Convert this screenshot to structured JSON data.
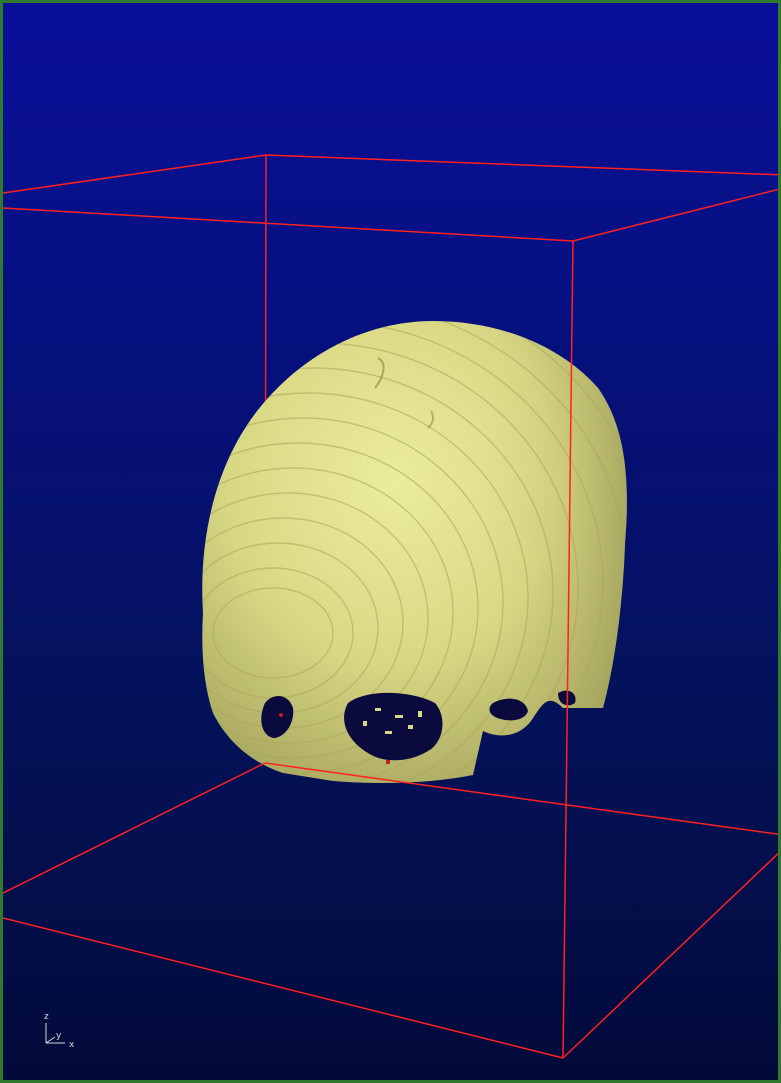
{
  "viewer": {
    "background_top": "#0a0f9a",
    "background_bottom": "#030a3a",
    "border_color": "#2f7a2f",
    "bounding_box_color": "#ff2020",
    "surface_color": "#dcdc8a"
  },
  "orientation_axes": {
    "z_label": "z",
    "y_label": "y",
    "x_label": "x"
  }
}
